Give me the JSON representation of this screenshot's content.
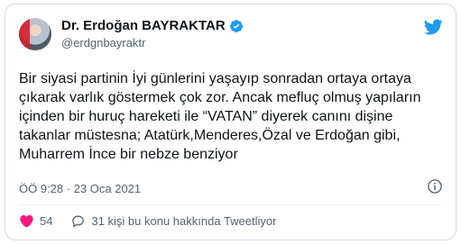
{
  "author": {
    "display_name": "Dr. Erdoğan BAYRAKTAR",
    "handle": "@erdgnbayraktr"
  },
  "tweet": {
    "text": "Bir siyasi partinin İyi günlerini yaşayıp sonradan ortaya ortaya çıkarak varlık göstermek çok zor. Ancak mefluç olmuş yapıların içinden bir huruç hareketi ile “VATAN” diyerek canını dişine takanlar müstesna; Atatürk,Menderes,Özal ve Erdoğan gibi, Muharrem İnce bir nebze benziyor",
    "timestamp": "ÖÖ 9:28 · 23 Oca 2021"
  },
  "actions": {
    "like_count": "54",
    "discussion_label": "31 kişi bu konu hakkında Tweetliyor"
  },
  "colors": {
    "brand": "#1d9bf0",
    "like_red": "#f91880",
    "muted": "#536471"
  },
  "icons": [
    "verified-badge-icon",
    "twitter-bird-icon",
    "info-icon",
    "heart-icon",
    "speech-bubble-icon"
  ]
}
